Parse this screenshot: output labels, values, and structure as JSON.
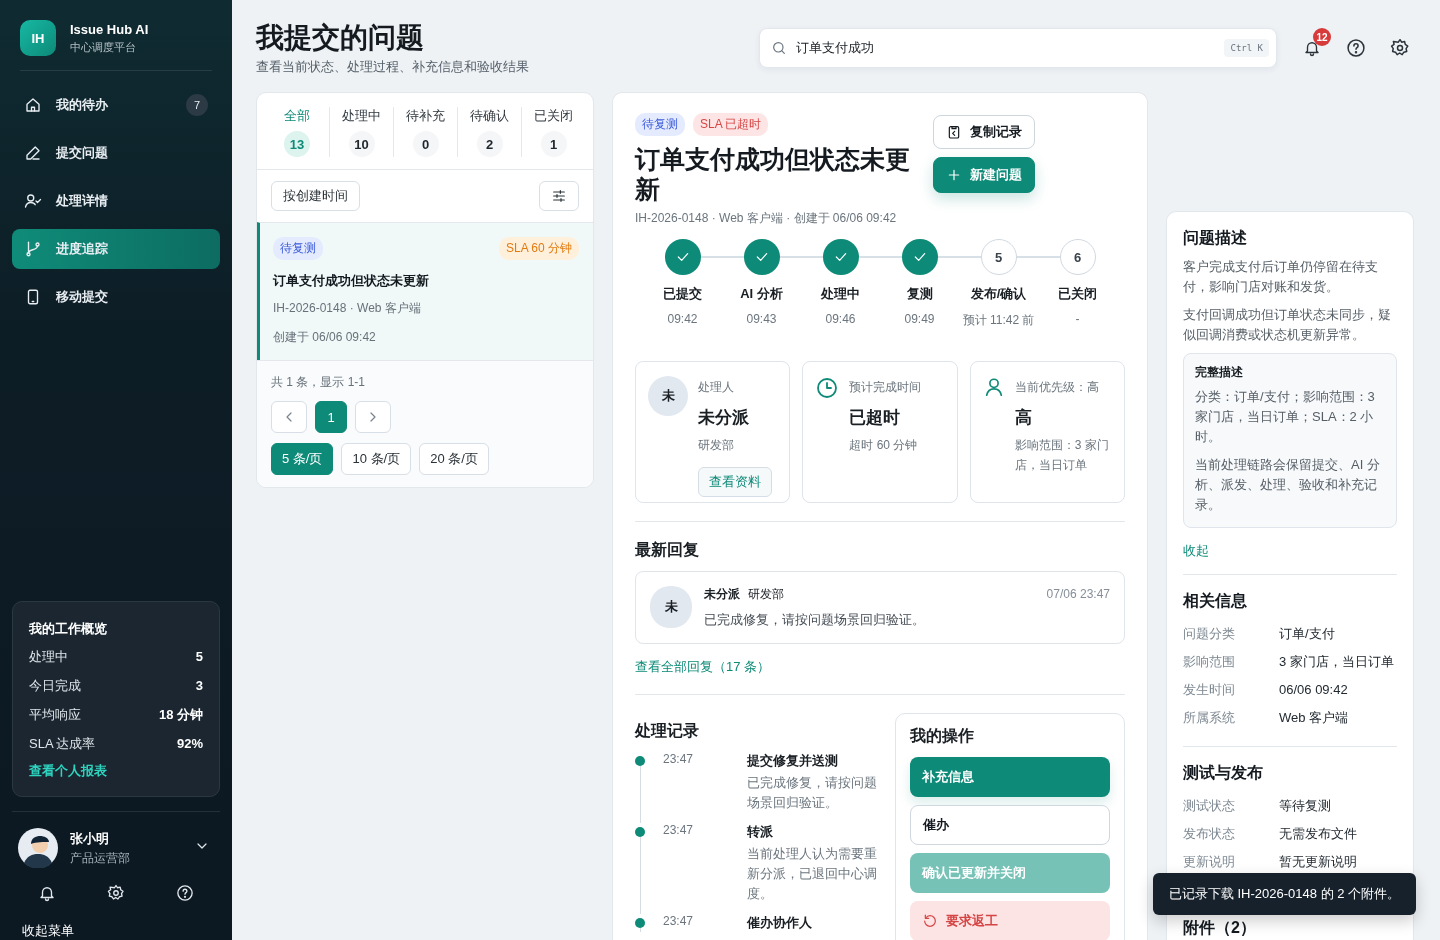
{
  "sidebar": {
    "logo": "IH",
    "app_name": "Issue Hub AI",
    "app_subtitle": "中心调度平台",
    "nav": [
      {
        "label": "我的待办",
        "badge": "7",
        "selected": false
      },
      {
        "label": "提交问题",
        "selected": false
      },
      {
        "label": "处理详情",
        "selected": false
      },
      {
        "label": "进度追踪",
        "selected": true
      },
      {
        "label": "移动提交",
        "selected": false
      }
    ],
    "overview": {
      "title": "我的工作概览",
      "rows": [
        {
          "label": "处理中",
          "value": "5"
        },
        {
          "label": "今日完成",
          "value": "3"
        },
        {
          "label": "平均响应",
          "value": "18 分钟"
        },
        {
          "label": "SLA 达成率",
          "value": "92%"
        }
      ],
      "link": "查看个人报表"
    },
    "user": {
      "name": "张小明",
      "dept": "产品运营部"
    },
    "collapse": "收起菜单"
  },
  "header": {
    "title": "我提交的问题",
    "subtitle": "查看当前状态、处理过程、补充信息和验收结果"
  },
  "search": {
    "value": "订单支付成功",
    "shortcut": "Ctrl K"
  },
  "notifications": {
    "badge": "12"
  },
  "list_panel": {
    "status_tabs": [
      {
        "label": "全部",
        "count": "13",
        "selected": true
      },
      {
        "label": "处理中",
        "count": "10",
        "selected": false
      },
      {
        "label": "待补充",
        "count": "0",
        "selected": false
      },
      {
        "label": "待确认",
        "count": "2",
        "selected": false
      },
      {
        "label": "已关闭",
        "count": "1",
        "selected": false
      }
    ],
    "sort": "按创建时间",
    "issues": [
      {
        "tags": [
          {
            "label": "待复测",
            "kind": "info"
          },
          {
            "label": "SLA 60 分钟",
            "kind": "warning"
          }
        ],
        "title": "订单支付成功但状态未更新",
        "meta": "IH-2026-0148 · Web 客户端",
        "created": "创建于 06/06 09:42",
        "selected": true
      }
    ],
    "summary": "共 1 条，显示 1-1",
    "pages": [
      {
        "label": "1",
        "selected": true
      }
    ],
    "page_sizes": [
      {
        "label": "5 条/页",
        "selected": true
      },
      {
        "label": "10 条/页",
        "selected": false
      },
      {
        "label": "20 条/页",
        "selected": false
      }
    ]
  },
  "detail": {
    "tags": [
      {
        "label": "待复测",
        "kind": "info"
      },
      {
        "label": "SLA 已超时",
        "kind": "danger"
      }
    ],
    "title": "订单支付成功但状态未更新",
    "meta": "IH-2026-0148 · Web 客户端 · 创建于 06/06 09:42",
    "buttons": [
      {
        "label": "复制记录",
        "kind": "outline"
      },
      {
        "label": "新建问题",
        "kind": "primary"
      }
    ],
    "steps": [
      {
        "label": "已提交",
        "time": "09:42",
        "done": true
      },
      {
        "label": "AI 分析",
        "time": "09:43",
        "done": true
      },
      {
        "label": "处理中",
        "time": "09:46",
        "done": true
      },
      {
        "label": "复测",
        "time": "09:49",
        "done": true
      },
      {
        "label": "发布/确认",
        "time": "预计 11:42 前",
        "done": false,
        "marker": "5"
      },
      {
        "label": "已关闭",
        "time": "-",
        "done": false,
        "marker": "6"
      }
    ],
    "cards": [
      {
        "kind": "assignee",
        "avatar": "未",
        "label": "处理人",
        "value": "未分派",
        "sub": "研发部",
        "link": "查看资料"
      },
      {
        "kind": "deadline",
        "label": "预计完成时间",
        "value": "已超时",
        "sub": "超时 60 分钟"
      },
      {
        "kind": "priority",
        "label": "当前优先级：高",
        "value": "高",
        "sub": "影响范围：3 家门店，当日订单"
      }
    ],
    "latest_reply": {
      "heading": "最新回复",
      "avatar": "未",
      "author": "未分派",
      "dept": "研发部",
      "time": "07/06 23:47",
      "text": "已完成修复，请按问题场景回归验证。",
      "all_link": "查看全部回复（17 条）"
    },
    "records": {
      "heading": "处理记录",
      "items": [
        {
          "time": "23:47",
          "title": "提交修复并送测",
          "text": "已完成修复，请按问题场景回归验证。"
        },
        {
          "time": "23:47",
          "title": "转派",
          "text": "当前处理人认为需要重新分派，已退回中心调度。"
        },
        {
          "time": "23:47",
          "title": "催办协作人"
        }
      ]
    },
    "actions": {
      "heading": "我的操作",
      "items": [
        {
          "label": "补充信息",
          "kind": "primary",
          "disabled": false
        },
        {
          "label": "催办",
          "kind": "outline",
          "disabled": false
        },
        {
          "label": "确认已更新并关闭",
          "kind": "primary",
          "disabled": true
        },
        {
          "label": "要求返工",
          "kind": "danger",
          "disabled": false
        }
      ]
    }
  },
  "info": {
    "description": {
      "heading": "问题描述",
      "paragraphs": [
        "客户完成支付后订单仍停留在待支付，影响门店对账和发货。",
        "支付回调成功但订单状态未同步，疑似回调消费或状态机更新异常。"
      ],
      "full": {
        "heading": "完整描述",
        "paragraphs": [
          "分类：订单/支付；影响范围：3 家门店，当日订单；SLA：2 小时。",
          "当前处理链路会保留提交、AI 分析、派发、处理、验收和补充记录。"
        ]
      },
      "collapse": "收起"
    },
    "related": {
      "heading": "相关信息",
      "rows": [
        {
          "label": "问题分类",
          "value": "订单/支付"
        },
        {
          "label": "影响范围",
          "value": "3 家门店，当日订单"
        },
        {
          "label": "发生时间",
          "value": "06/06 09:42"
        },
        {
          "label": "所属系统",
          "value": "Web 客户端"
        }
      ]
    },
    "release": {
      "heading": "测试与发布",
      "rows": [
        {
          "label": "测试状态",
          "value": "等待复测"
        },
        {
          "label": "发布状态",
          "value": "无需发布文件"
        },
        {
          "label": "更新说明",
          "value": "暂无更新说明"
        }
      ]
    },
    "attachments": {
      "heading": "附件（2）"
    }
  },
  "toast": {
    "text": "已记录下载 IH-2026-0148 的 2 个附件。"
  }
}
